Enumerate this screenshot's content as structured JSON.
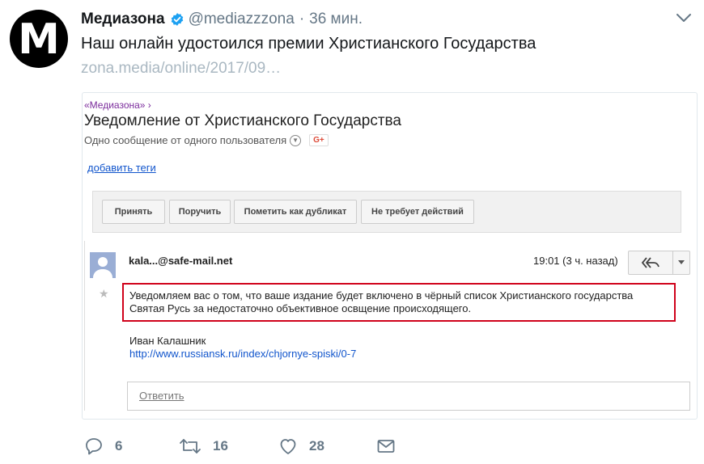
{
  "tweet": {
    "avatar_letter": "M",
    "author_name": "Медиазона",
    "handle": "@mediazzzona",
    "separator": "·",
    "time": "36 мин.",
    "text": "Наш онлайн удостоился премии Христианского Государства",
    "link": "zona.media/online/2017/09…"
  },
  "email": {
    "breadcrumb": "«Медиазона» ›",
    "subject": "Уведомление от Христианского Государства",
    "meta": "Одно сообщение от одного пользователя",
    "gplus": "G+",
    "add_tags": "добавить теги",
    "toolbar": [
      "Принять",
      "Поручить",
      "Пометить как дубликат",
      "Не требует действий"
    ],
    "sender": "kala...@safe-mail.net",
    "time": "19:01 (3 ч. назад)",
    "body_line1": "Уведомляем вас о том, что ваше издание будет включено в чёрный список Христианского государства",
    "body_line2": "Святая Русь за недостаточно объективное освщение происходящего.",
    "signature": "Иван Калашник",
    "signature_link": "http://www.russiansk.ru/index/chjornye-spiski/0-7",
    "reply_placeholder": "Ответить"
  },
  "actions": {
    "replies": "6",
    "retweets": "16",
    "likes": "28"
  },
  "colors": {
    "verified": "#1da1f2",
    "highlight": "#d0021b",
    "link": "#1155cc",
    "muted": "#657786"
  }
}
